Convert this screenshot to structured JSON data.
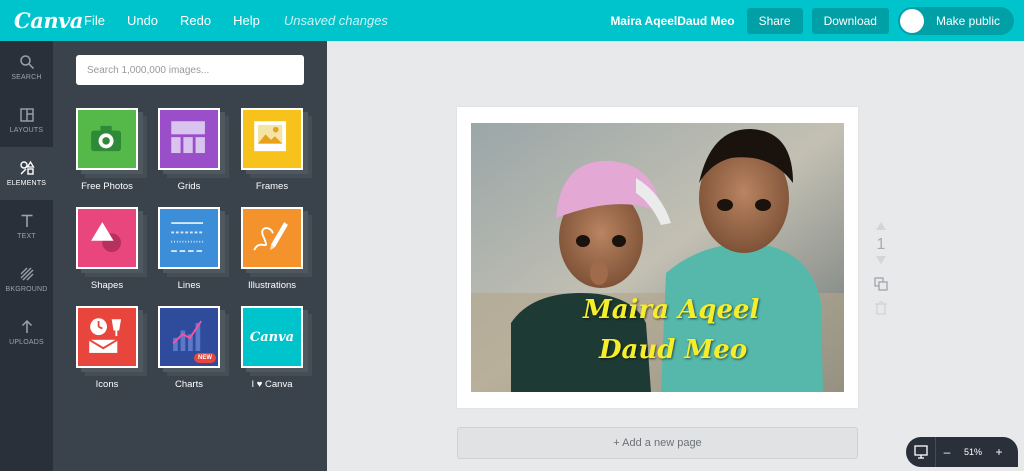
{
  "app": {
    "logo": "Canva",
    "menu": [
      "File",
      "Undo",
      "Redo",
      "Help"
    ],
    "status": "Unsaved changes",
    "user_name": "Maira AqeelDaud Meo",
    "share_label": "Share",
    "download_label": "Download",
    "make_public_label": "Make public"
  },
  "rail": {
    "items": [
      {
        "label": "SEARCH",
        "icon": "search-icon"
      },
      {
        "label": "LAYOUTS",
        "icon": "layouts-icon"
      },
      {
        "label": "ELEMENTS",
        "icon": "elements-icon",
        "active": true
      },
      {
        "label": "TEXT",
        "icon": "text-icon"
      },
      {
        "label": "BKGROUND",
        "icon": "background-icon"
      },
      {
        "label": "UPLOADS",
        "icon": "upload-icon"
      }
    ]
  },
  "panel": {
    "search_placeholder": "Search 1,000,000 images...",
    "tiles": [
      {
        "label": "Free Photos",
        "color": "#54b948"
      },
      {
        "label": "Grids",
        "color": "#9a4fc9"
      },
      {
        "label": "Frames",
        "color": "#f7c21c"
      },
      {
        "label": "Shapes",
        "color": "#e8467c"
      },
      {
        "label": "Lines",
        "color": "#3d8ed8"
      },
      {
        "label": "Illustrations",
        "color": "#f4932b"
      },
      {
        "label": "Icons",
        "color": "#e8453c"
      },
      {
        "label": "Charts",
        "color": "#2f4b9c",
        "badge": "NEW"
      },
      {
        "label": "I ♥ Canva",
        "color": "#00c4cc",
        "inner": "Canva"
      }
    ]
  },
  "design": {
    "text_line1": "Maira Aqeel",
    "text_line2": "Daud Meo",
    "page_number": "1",
    "add_page_label": "+ Add a new page"
  },
  "zoom": {
    "value": "51%",
    "minus": "–",
    "plus": "+"
  },
  "colors": {
    "brand": "#00c4cc",
    "rail_bg": "#293039",
    "panel_bg": "#3a424c",
    "overlay_text": "#f6ee2b"
  }
}
